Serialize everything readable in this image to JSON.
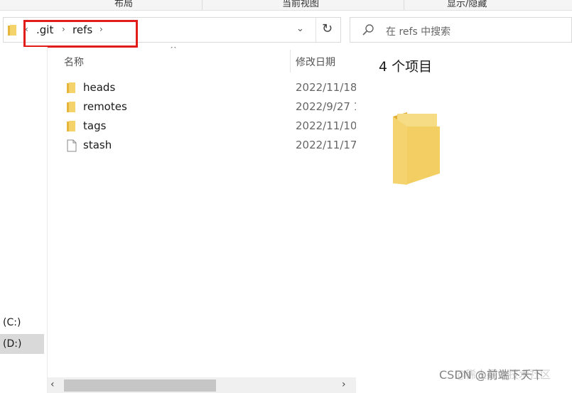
{
  "ribbon": {
    "tabs": [
      "布局",
      "当前视图",
      "显示/隐藏"
    ]
  },
  "address": {
    "crumbs": [
      ".git",
      "refs"
    ],
    "overflow_glyph": "‹",
    "chevron_glyph": "›",
    "dropdown_glyph": "⌄",
    "refresh_glyph": "↻"
  },
  "search": {
    "placeholder": "在 refs 中搜索"
  },
  "nav": {
    "drives": [
      {
        "label": "(C:)"
      },
      {
        "label": "(D:)"
      }
    ]
  },
  "columns": {
    "name": "名称",
    "modified": "修改日期",
    "sort_glyph": "^"
  },
  "files": [
    {
      "name": "heads",
      "date": "2022/11/18",
      "type": "folder"
    },
    {
      "name": "remotes",
      "date": "2022/9/27 1",
      "type": "folder"
    },
    {
      "name": "tags",
      "date": "2022/11/10",
      "type": "folder"
    },
    {
      "name": "stash",
      "date": "2022/11/17",
      "type": "file"
    }
  ],
  "preview": {
    "title": "4 个项目"
  },
  "scrollbar": {
    "left_glyph": "‹",
    "right_glyph": "›"
  },
  "watermark": {
    "primary": "CSDN @前端下夭下",
    "secondary": "@稀土掘金技术社区"
  },
  "colors": {
    "folder": "#f5d36b",
    "folder_dark": "#e6b53b",
    "highlight_box": "#e21b1b",
    "selected_drive": "#d9d9d9"
  }
}
